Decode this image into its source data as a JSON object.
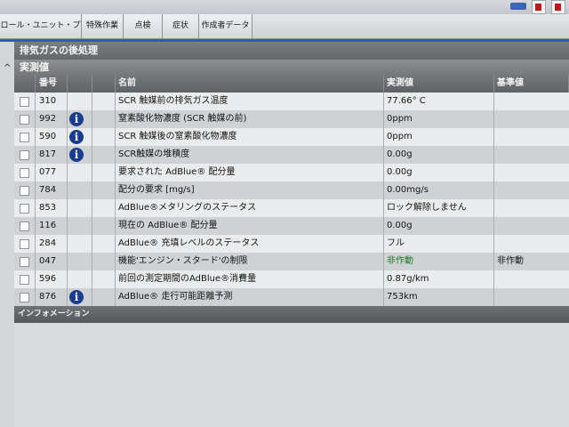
{
  "tabs": [
    {
      "label": "ロール・ユニット・プロトコル"
    },
    {
      "label": "特殊作業"
    },
    {
      "label": "点検"
    },
    {
      "label": "症状"
    },
    {
      "label": "作成者データ"
    }
  ],
  "section": {
    "title": "排気ガスの後処理",
    "collapse_glyph": "^",
    "subtitle": "実測値"
  },
  "table": {
    "headers": {
      "num": "番号",
      "name": "名前",
      "value": "実測値",
      "standard": "基準値"
    },
    "rows": [
      {
        "num": "310",
        "info": false,
        "name": "SCR 触媒前の排気ガス温度",
        "value": "77.66° C",
        "standard": "",
        "value_color": ""
      },
      {
        "num": "992",
        "info": true,
        "name": "窒素酸化物濃度 (SCR 触媒の前)",
        "value": "0ppm",
        "standard": "",
        "value_color": ""
      },
      {
        "num": "590",
        "info": true,
        "name": "SCR 触媒後の窒素酸化物濃度",
        "value": "0ppm",
        "standard": "",
        "value_color": ""
      },
      {
        "num": "817",
        "info": true,
        "name": "SCR触媒の堆積度",
        "value": "0.00g",
        "standard": "",
        "value_color": ""
      },
      {
        "num": "077",
        "info": false,
        "name": "要求された AdBlue® 配分量",
        "value": "0.00g",
        "standard": "",
        "value_color": ""
      },
      {
        "num": "784",
        "info": false,
        "name": "配分の要求 [mg/s]",
        "value": "0.00mg/s",
        "standard": "",
        "value_color": ""
      },
      {
        "num": "853",
        "info": false,
        "name": "AdBlue®メタリングのステータス",
        "value": "ロック解除しません",
        "standard": "",
        "value_color": ""
      },
      {
        "num": "116",
        "info": false,
        "name": "現在の AdBlue® 配分量",
        "value": "0.00g",
        "standard": "",
        "value_color": ""
      },
      {
        "num": "284",
        "info": false,
        "name": "AdBlue® 充填レベルのステータス",
        "value": "フル",
        "standard": "",
        "value_color": ""
      },
      {
        "num": "047",
        "info": false,
        "name": "機能'エンジン・スタード'の制限",
        "value": "非作動",
        "standard": "非作動",
        "value_color": "#1f7a28"
      },
      {
        "num": "596",
        "info": false,
        "name": "前回の測定期間のAdBlue®消費量",
        "value": "0.87g/km",
        "standard": "",
        "value_color": ""
      },
      {
        "num": "876",
        "info": true,
        "name": "AdBlue® 走行可能距離予測",
        "value": "753km",
        "standard": "",
        "value_color": ""
      }
    ]
  },
  "info_panel": {
    "title": "インフォメーション"
  },
  "icons": {
    "info": "i",
    "info_name": "info-icon"
  }
}
